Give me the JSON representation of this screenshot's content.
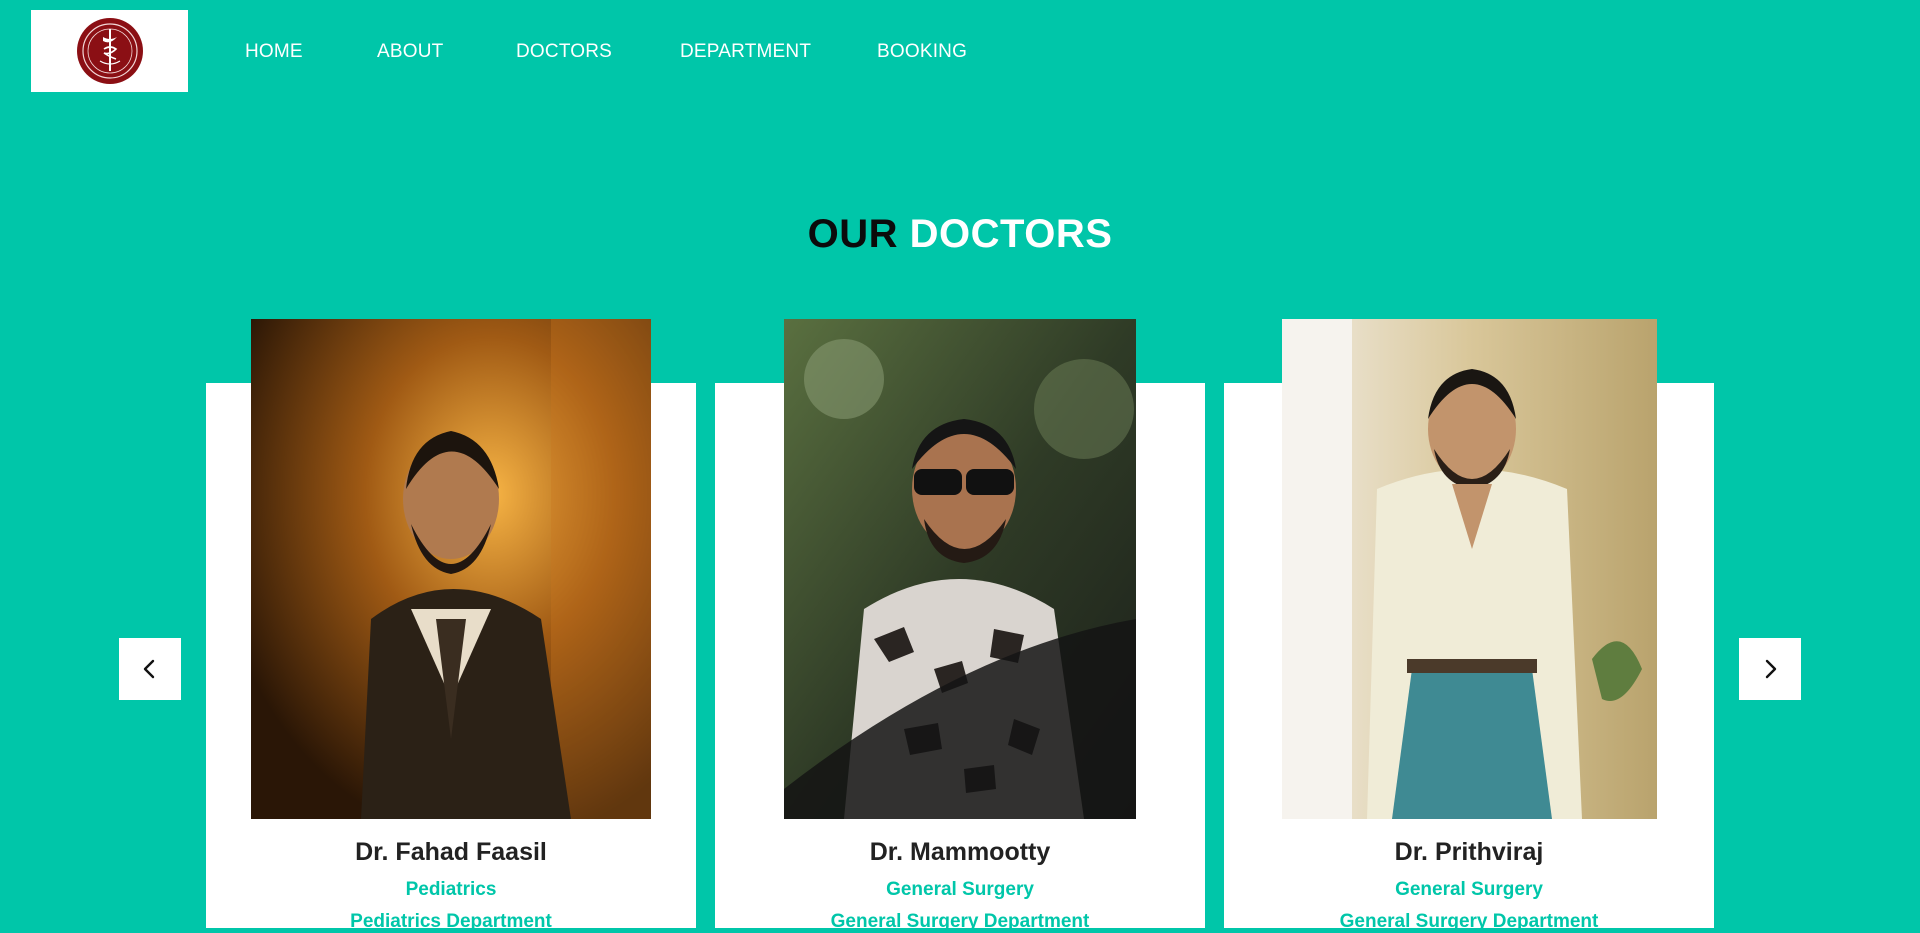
{
  "nav": {
    "items": [
      {
        "label": "HOME"
      },
      {
        "label": "ABOUT"
      },
      {
        "label": "DOCTORS"
      },
      {
        "label": "DEPARTMENT"
      },
      {
        "label": "BOOKING"
      }
    ]
  },
  "heading": {
    "part1": "OUR",
    "part2": "DOCTORS"
  },
  "doctors": [
    {
      "name": "Dr. Fahad Faasil",
      "specialty": "Pediatrics",
      "department": "Pediatrics Department"
    },
    {
      "name": "Dr. Mammootty",
      "specialty": "General Surgery",
      "department": "General Surgery Department"
    },
    {
      "name": "Dr. Prithviraj",
      "specialty": "General Surgery",
      "department": "General Surgery Department"
    }
  ],
  "colors": {
    "background": "#00c6a9",
    "accent_text": "#00c6a9",
    "logo_emblem": "#8b0f14"
  },
  "icons": {
    "prev": "chevron-left-icon",
    "next": "chevron-right-icon",
    "logo": "hospital-emblem-logo"
  }
}
